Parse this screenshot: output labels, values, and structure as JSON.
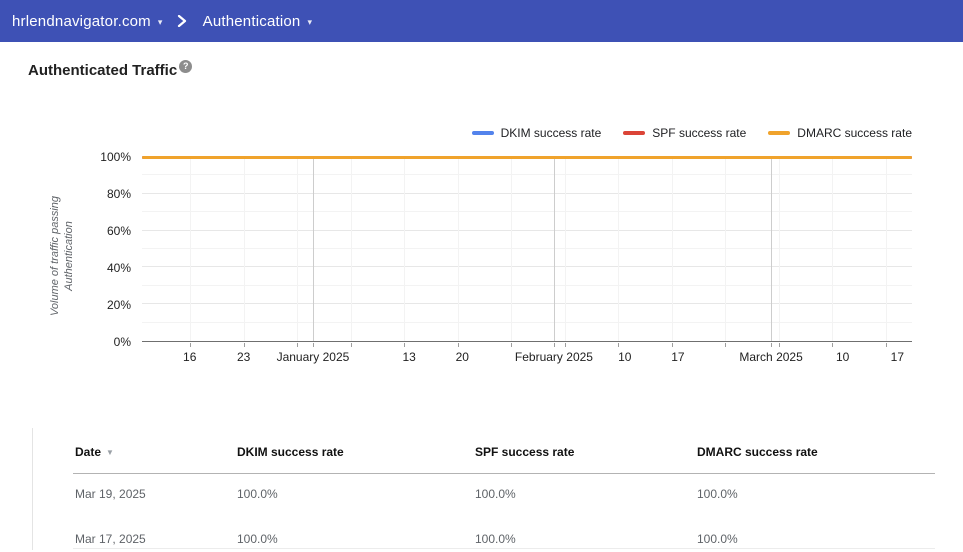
{
  "topbar": {
    "domain": "hrlendnavigator.com",
    "section": "Authentication",
    "background_color": "#3E51B5"
  },
  "page": {
    "title": "Authenticated Traffic"
  },
  "icons": {
    "caret_down": "▾",
    "help": "?",
    "sort_desc": "▼"
  },
  "chart_data": {
    "type": "line",
    "title": "Authenticated Traffic",
    "xlabel": "",
    "ylabel": "Volume of traffic passing Authentication",
    "ylim": [
      0,
      100
    ],
    "grid": true,
    "legend_position": "top-right",
    "y_tick_labels": [
      "100%",
      "80%",
      "60%",
      "40%",
      "20%",
      "0%"
    ],
    "x_tick_labels": [
      {
        "label": "16",
        "pos": 6.2
      },
      {
        "label": "23",
        "pos": 13.2
      },
      {
        "label": "January 2025",
        "pos": 22.2
      },
      {
        "label": "13",
        "pos": 34.7
      },
      {
        "label": "20",
        "pos": 41.6
      },
      {
        "label": "February 2025",
        "pos": 53.5
      },
      {
        "label": "10",
        "pos": 62.7
      },
      {
        "label": "17",
        "pos": 69.6
      },
      {
        "label": "March 2025",
        "pos": 81.7
      },
      {
        "label": "10",
        "pos": 91.0
      },
      {
        "label": "17",
        "pos": 98.1
      }
    ],
    "week_gridline_pos": [
      6.2,
      13.2,
      20.1,
      27.1,
      34.0,
      41.0,
      47.9,
      54.9,
      61.8,
      68.8,
      75.7,
      82.7,
      89.6,
      96.6
    ],
    "month_gridline_pos": [
      22.2,
      53.5,
      81.7
    ],
    "series": [
      {
        "name": "DKIM success rate",
        "color": "#5383EC",
        "value_percent": 100
      },
      {
        "name": "SPF success rate",
        "color": "#DB4437",
        "value_percent": 100
      },
      {
        "name": "DMARC success rate",
        "color": "#F0A32C",
        "value_percent": 100
      }
    ]
  },
  "table": {
    "columns": [
      {
        "label": "Date",
        "sortable": true
      },
      {
        "label": "DKIM success rate",
        "sortable": false
      },
      {
        "label": "SPF success rate",
        "sortable": false
      },
      {
        "label": "DMARC success rate",
        "sortable": false
      }
    ],
    "rows": [
      [
        "Mar 19, 2025",
        "100.0%",
        "100.0%",
        "100.0%"
      ],
      [
        "Mar 17, 2025",
        "100.0%",
        "100.0%",
        "100.0%"
      ]
    ]
  }
}
